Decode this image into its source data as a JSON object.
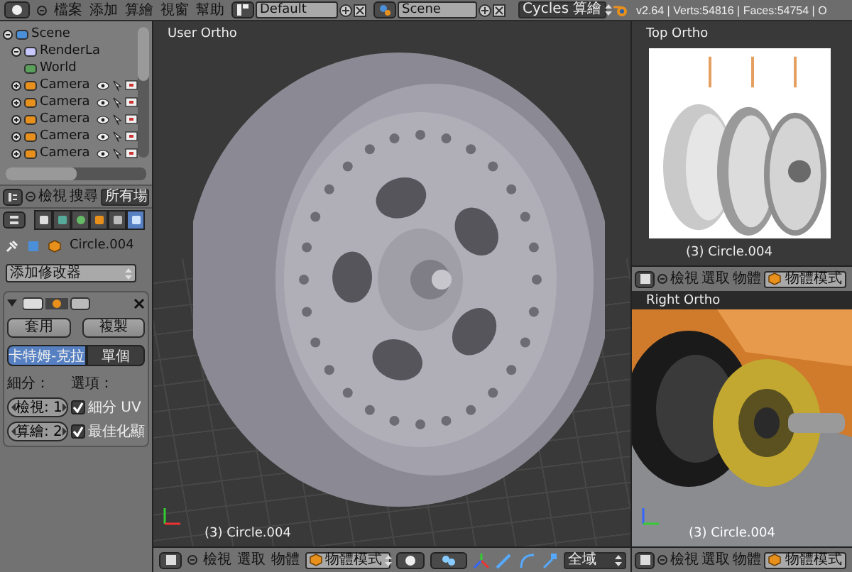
{
  "menu_bar": {
    "menus": [
      "檔案",
      "添加",
      "算繪",
      "視窗",
      "幫助"
    ],
    "layout": "Default",
    "scene": "Scene",
    "render_engine": "Cycles 算繪",
    "stats": "v2.64 | Verts:54816 | Faces:54754 | O"
  },
  "outliner": {
    "items": [
      {
        "label": "Scene",
        "kind": "scene",
        "expanded": true,
        "children": [
          {
            "label": "RenderLa",
            "kind": "render_layers",
            "expanded": true
          },
          {
            "label": "World",
            "kind": "world"
          },
          {
            "label": "Camera",
            "kind": "camera",
            "expanded": false
          },
          {
            "label": "Camera",
            "kind": "camera",
            "expanded": false
          },
          {
            "label": "Camera",
            "kind": "camera",
            "expanded": false
          },
          {
            "label": "Camera",
            "kind": "camera",
            "expanded": false
          },
          {
            "label": "Camera",
            "kind": "camera",
            "expanded": false
          }
        ]
      }
    ],
    "header": {
      "menus": [
        "檢視",
        "搜尋"
      ],
      "filter": "所有場"
    }
  },
  "properties": {
    "tabs": [
      {
        "kind": "render",
        "selected": false
      },
      {
        "kind": "scene",
        "selected": false
      },
      {
        "kind": "world",
        "selected": false
      },
      {
        "kind": "object",
        "selected": false
      },
      {
        "kind": "constraints",
        "selected": false
      },
      {
        "kind": "modifiers",
        "selected": true
      }
    ],
    "object_name": "Circle.004",
    "add_modifier": "添加修改器",
    "modifier": {
      "apply": "套用",
      "copy": "複製",
      "types": [
        {
          "label": "卡特姆-克拉",
          "selected": true
        },
        {
          "label": "單個",
          "selected": false
        }
      ],
      "subdivisions_label": "細分：",
      "view_field": "檢視: 1",
      "render_field": "算繪: 2",
      "options_label": "選項：",
      "options": [
        {
          "label": "細分 UV",
          "checked": true
        },
        {
          "label": "最佳化顯",
          "checked": true
        }
      ]
    }
  },
  "main_viewport": {
    "title": "User Ortho",
    "object_label": "(3) Circle.004",
    "header": {
      "menus": [
        "檢視",
        "選取",
        "物體"
      ],
      "mode": "物體模式",
      "orientation": "全域"
    }
  },
  "top_viewport": {
    "title": "Top Ortho",
    "object_label": "(3) Circle.004",
    "header": {
      "menus": [
        "檢視",
        "選取",
        "物體"
      ],
      "mode": "物體模式"
    }
  },
  "right_viewport": {
    "title": "Right Ortho",
    "object_label": "(3) Circle.004",
    "header": {
      "menus": [
        "檢視",
        "選取",
        "物體"
      ],
      "mode": "物體模式"
    }
  }
}
